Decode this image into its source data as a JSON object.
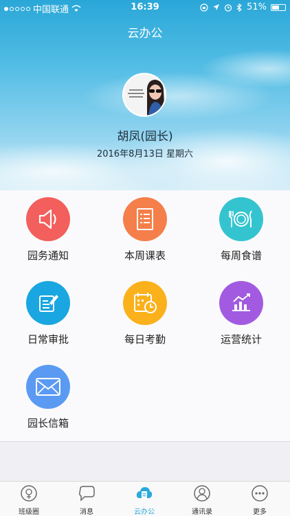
{
  "status": {
    "carrier": "中国联通",
    "time": "16:39",
    "battery": "51%"
  },
  "header": {
    "title": "云办公"
  },
  "profile": {
    "name": "胡凤(园长)",
    "date": "2016年8月13日  星期六"
  },
  "grid": [
    {
      "label": "园务通知",
      "icon": "speaker-icon",
      "color": "#f25f5c"
    },
    {
      "label": "本周课表",
      "icon": "document-list-icon",
      "color": "#f47f4a"
    },
    {
      "label": "每周食谱",
      "icon": "plate-cutlery-icon",
      "color": "#34c4cf"
    },
    {
      "label": "日常审批",
      "icon": "edit-note-icon",
      "color": "#1aa6e0"
    },
    {
      "label": "每日考勤",
      "icon": "calendar-clock-icon",
      "color": "#fbb11b"
    },
    {
      "label": "运营统计",
      "icon": "chart-icon",
      "color": "#a25be0"
    },
    {
      "label": "园长信箱",
      "icon": "envelope-icon",
      "color": "#5a9af2"
    }
  ],
  "tabs": [
    {
      "label": "班级圈",
      "icon": "class-circle-icon"
    },
    {
      "label": "消息",
      "icon": "chat-bubble-icon"
    },
    {
      "label": "云办公",
      "icon": "cloud-doc-icon"
    },
    {
      "label": "通讯录",
      "icon": "contact-icon"
    },
    {
      "label": "更多",
      "icon": "more-icon"
    }
  ],
  "colors": {
    "accent": "#29a9dc"
  }
}
